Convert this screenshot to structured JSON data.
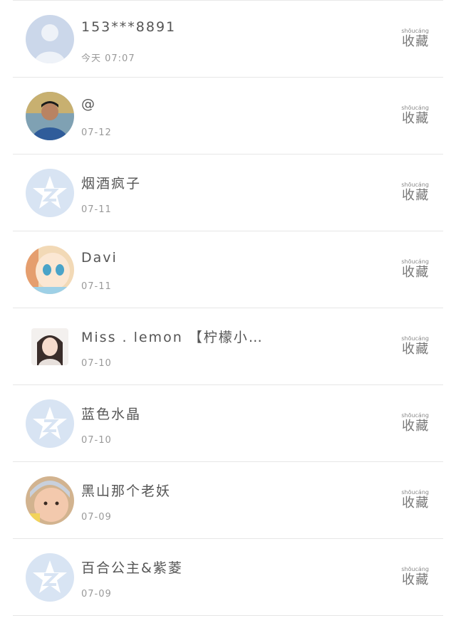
{
  "items": [
    {
      "name": "153***8891",
      "time": "今天 07:07",
      "avatar": "default-person-avatar",
      "action": "收藏"
    },
    {
      "name": "@",
      "time": "07-12",
      "avatar": "photo-avatar-boy",
      "action": "收藏"
    },
    {
      "name": "烟酒疯子",
      "time": "07-11",
      "avatar": "qzone-star-avatar",
      "action": "收藏"
    },
    {
      "name": "Davi",
      "time": "07-11",
      "avatar": "anime-avatar",
      "action": "收藏"
    },
    {
      "name": "Miss . lemon 【柠檬小…",
      "time": "07-10",
      "avatar": "photo-avatar-girl",
      "action": "收藏"
    },
    {
      "name": "蓝色水晶",
      "time": "07-10",
      "avatar": "qzone-star-avatar",
      "action": "收藏"
    },
    {
      "name": "黑山那个老妖",
      "time": "07-09",
      "avatar": "photo-avatar-baby",
      "action": "收藏"
    },
    {
      "name": "百合公主&紫菱",
      "time": "07-09",
      "avatar": "qzone-star-avatar",
      "action": "收藏"
    }
  ],
  "colors": {
    "divider": "#e6e6e6",
    "name_text": "#555555",
    "time_text": "#999999",
    "placeholder_avatar": "#d7e3f2"
  }
}
